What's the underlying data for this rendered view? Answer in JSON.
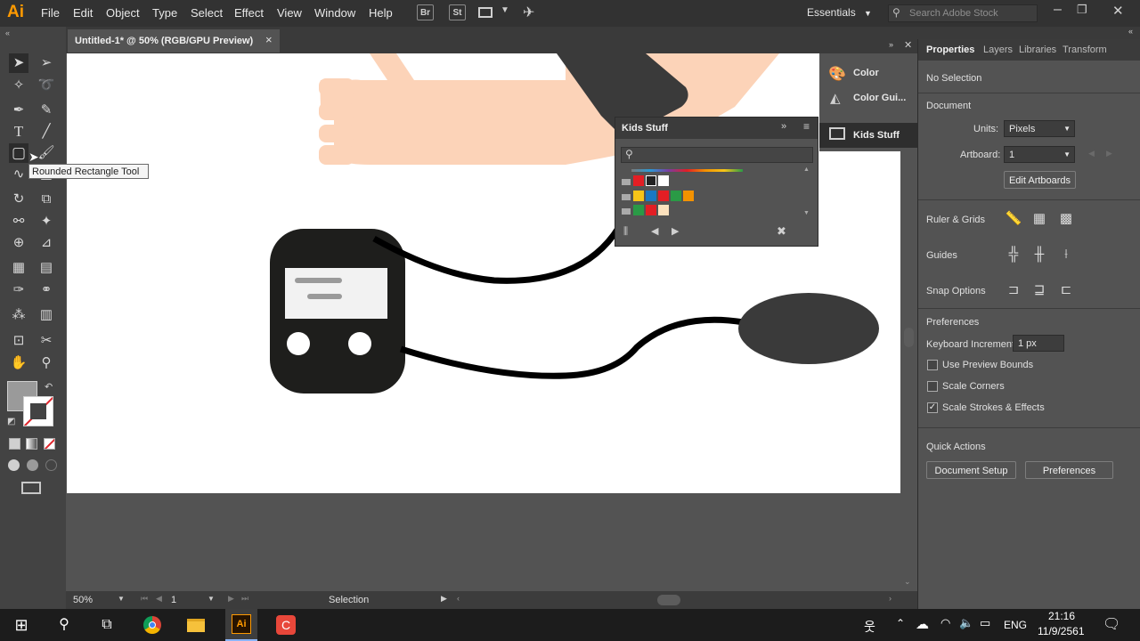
{
  "app": {
    "logo": "Ai"
  },
  "menu": [
    "File",
    "Edit",
    "Object",
    "Type",
    "Select",
    "Effect",
    "View",
    "Window",
    "Help"
  ],
  "menubar_icons": {
    "br": "Br",
    "st": "St"
  },
  "workspace": {
    "label": "Essentials"
  },
  "search": {
    "placeholder": "Search Adobe Stock"
  },
  "document_tab": {
    "title": "Untitled-1* @ 50% (RGB/GPU Preview)",
    "close": "×"
  },
  "tooltip": "Rounded Rectangle Tool",
  "collapsed_panels": [
    {
      "label": "Color",
      "icon": "color-palette-icon"
    },
    {
      "label": "Color Gui...",
      "icon": "color-guide-icon"
    },
    {
      "label": "Kids Stuff",
      "icon": "swatch-library-icon"
    }
  ],
  "kids_panel": {
    "title": "Kids Stuff",
    "colors": {
      "red": "#e31e24",
      "black": "#222222",
      "white": "#ffffff",
      "yellow": "#f6c418",
      "blue": "#1a78c2",
      "green": "#2a9a46",
      "orange": "#f39200",
      "skin": "#fce1bd"
    }
  },
  "properties": {
    "tabs": [
      "Properties",
      "Layers",
      "Libraries",
      "Transform"
    ],
    "selection": "No Selection",
    "document_heading": "Document",
    "units_label": "Units:",
    "units_value": "Pixels",
    "artboard_label": "Artboard:",
    "artboard_value": "1",
    "edit_artboards": "Edit Artboards",
    "ruler_grids": "Ruler & Grids",
    "guides": "Guides",
    "snap_options": "Snap Options",
    "preferences_heading": "Preferences",
    "keyboard_increment_label": "Keyboard Increment:",
    "keyboard_increment_value": "1 px",
    "use_preview_bounds": "Use Preview Bounds",
    "scale_corners": "Scale Corners",
    "scale_strokes": "Scale Strokes & Effects",
    "quick_actions": "Quick Actions",
    "document_setup": "Document Setup",
    "preferences_button": "Preferences",
    "checkboxes": {
      "use_preview_bounds": false,
      "scale_corners": false,
      "scale_strokes": true
    }
  },
  "status": {
    "zoom": "50%",
    "artboard": "1",
    "tool": "Selection"
  },
  "taskbar": {
    "lang": "ENG",
    "time": "21:16",
    "date": "11/9/2561"
  },
  "illustration": {
    "skin": "#fcd3b8",
    "dark": "#1e1e1c",
    "screen_white": "#f2f2f2",
    "line_gray": "#9a9a9a"
  }
}
